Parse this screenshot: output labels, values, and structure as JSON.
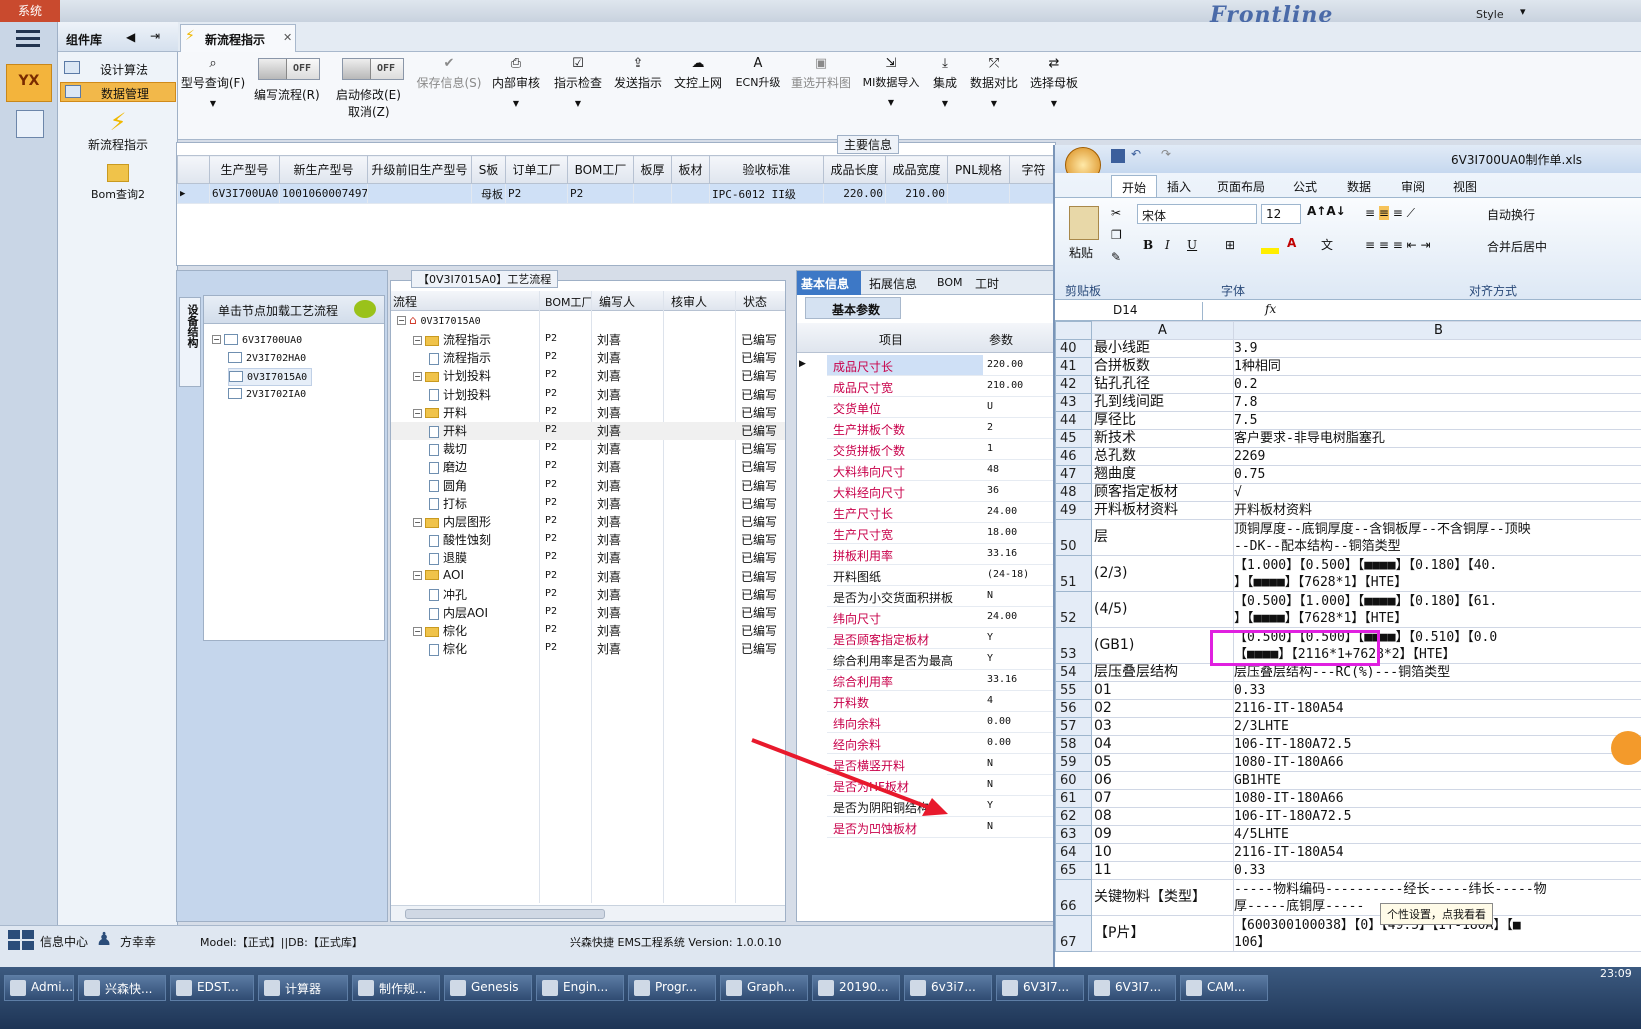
{
  "top": {
    "system_label": "系统",
    "brand": "Frontline",
    "style_label": "Style"
  },
  "sidebar": {
    "logo": "YX",
    "panel_title": "组件库",
    "items": [
      {
        "label": "设计算法"
      },
      {
        "label": "数据管理"
      }
    ],
    "tools": [
      {
        "label": "新流程指示"
      },
      {
        "label": "Bom查询2"
      }
    ]
  },
  "tab": {
    "label": "新流程指示"
  },
  "toolbar": {
    "type_query": "型号查询(F)",
    "write_flow_toggle": "OFF",
    "write_flow": "编写流程(R)",
    "start_modify_toggle": "OFF",
    "start_modify": "启动修改(E)",
    "cancel": "取消(Z)",
    "save": "保存信息(S)",
    "internal_review": "内部审核",
    "instruction_check": "指示检查",
    "send": "发送指示",
    "upload": "文控上网",
    "ecn": "ECN升级",
    "regen": "重选开料图",
    "mi_import": "MI数据导入",
    "integrate": "集成",
    "compare": "数据对比",
    "select_board": "选择母板"
  },
  "main_info": {
    "title": "主要信息",
    "columns": [
      "生产型号",
      "新生产型号",
      "升级前旧生产型号",
      "S板",
      "订单工厂",
      "BOM工厂",
      "板厚",
      "板材",
      "验收标准",
      "成品长度",
      "成品宽度",
      "PNL规格",
      "字符"
    ],
    "row": [
      "6V3I700UA0",
      "10010600074979",
      "",
      "母板",
      "P2",
      "P2",
      "",
      "",
      "IPC-6012 II级",
      "220.00",
      "210.00",
      "",
      ""
    ]
  },
  "struct": {
    "side_tab": "设备结构",
    "hint": "单击节点加载工艺流程",
    "root": "6V3I700UA0",
    "children": [
      "2V3I702HA0",
      "0V3I7015A0",
      "2V3I702IA0"
    ]
  },
  "flow": {
    "title": "【0V3I7015A0】工艺流程",
    "columns": [
      "流程",
      "BOM工厂",
      "编写人",
      "核审人",
      "状态"
    ],
    "root": "0V3I7015A0",
    "rows": [
      {
        "name": "流程指示",
        "level": 1,
        "folder": true,
        "bom": "P2",
        "writer": "刘喜",
        "status": "已编写"
      },
      {
        "name": "流程指示",
        "level": 2,
        "folder": false,
        "bom": "P2",
        "writer": "刘喜",
        "status": "已编写"
      },
      {
        "name": "计划投料",
        "level": 1,
        "folder": true,
        "bom": "P2",
        "writer": "刘喜",
        "status": "已编写"
      },
      {
        "name": "计划投料",
        "level": 2,
        "folder": false,
        "bom": "P2",
        "writer": "刘喜",
        "status": "已编写"
      },
      {
        "name": "开料",
        "level": 1,
        "folder": true,
        "bom": "P2",
        "writer": "刘喜",
        "status": "已编写"
      },
      {
        "name": "开料",
        "level": 2,
        "folder": false,
        "bom": "P2",
        "writer": "刘喜",
        "status": "已编写"
      },
      {
        "name": "裁切",
        "level": 2,
        "folder": false,
        "bom": "P2",
        "writer": "刘喜",
        "status": "已编写"
      },
      {
        "name": "磨边",
        "level": 2,
        "folder": false,
        "bom": "P2",
        "writer": "刘喜",
        "status": "已编写"
      },
      {
        "name": "圆角",
        "level": 2,
        "folder": false,
        "bom": "P2",
        "writer": "刘喜",
        "status": "已编写"
      },
      {
        "name": "打标",
        "level": 2,
        "folder": false,
        "bom": "P2",
        "writer": "刘喜",
        "status": "已编写"
      },
      {
        "name": "内层图形",
        "level": 1,
        "folder": true,
        "bom": "P2",
        "writer": "刘喜",
        "status": "已编写"
      },
      {
        "name": "酸性蚀刻",
        "level": 2,
        "folder": false,
        "bom": "P2",
        "writer": "刘喜",
        "status": "已编写"
      },
      {
        "name": "退膜",
        "level": 2,
        "folder": false,
        "bom": "P2",
        "writer": "刘喜",
        "status": "已编写"
      },
      {
        "name": "AOI",
        "level": 1,
        "folder": true,
        "bom": "P2",
        "writer": "刘喜",
        "status": "已编写"
      },
      {
        "name": "冲孔",
        "level": 2,
        "folder": false,
        "bom": "P2",
        "writer": "刘喜",
        "status": "已编写"
      },
      {
        "name": "内层AOI",
        "level": 2,
        "folder": false,
        "bom": "P2",
        "writer": "刘喜",
        "status": "已编写"
      },
      {
        "name": "棕化",
        "level": 1,
        "folder": true,
        "bom": "P2",
        "writer": "刘喜",
        "status": "已编写"
      },
      {
        "name": "棕化",
        "level": 2,
        "folder": false,
        "bom": "P2",
        "writer": "刘喜",
        "status": "已编写"
      }
    ]
  },
  "params": {
    "tabs": [
      "基本信息",
      "拓展信息",
      "BOM",
      "工时"
    ],
    "subtab": "基本参数",
    "columns": [
      "项目",
      "参数"
    ],
    "rows": [
      {
        "k": "成品尺寸长",
        "v": "220.00",
        "red": true
      },
      {
        "k": "成品尺寸宽",
        "v": "210.00",
        "red": true
      },
      {
        "k": "交货单位",
        "v": "U",
        "red": true
      },
      {
        "k": "生产拼板个数",
        "v": "2",
        "red": true
      },
      {
        "k": "交货拼板个数",
        "v": "1",
        "red": true
      },
      {
        "k": "大料纬向尺寸",
        "v": "48",
        "red": true
      },
      {
        "k": "大料经向尺寸",
        "v": "36",
        "red": true
      },
      {
        "k": "生产尺寸长",
        "v": "24.00",
        "red": true
      },
      {
        "k": "生产尺寸宽",
        "v": "18.00",
        "red": true
      },
      {
        "k": "拼板利用率",
        "v": "33.16",
        "red": true
      },
      {
        "k": "开料图纸",
        "v": "(24-18)",
        "red": false
      },
      {
        "k": "是否为小交货面积拼板",
        "v": "N",
        "red": false
      },
      {
        "k": "纬向尺寸",
        "v": "24.00",
        "red": true
      },
      {
        "k": "是否顾客指定板材",
        "v": "Y",
        "red": true
      },
      {
        "k": "综合利用率是否为最高",
        "v": "Y",
        "red": false
      },
      {
        "k": "综合利用率",
        "v": "33.16",
        "red": true
      },
      {
        "k": "开料数",
        "v": "4",
        "red": true
      },
      {
        "k": "纬向余料",
        "v": "0.00",
        "red": true
      },
      {
        "k": "经向余料",
        "v": "0.00",
        "red": true
      },
      {
        "k": "是否横竖开料",
        "v": "N",
        "red": true
      },
      {
        "k": "是否为HF板材",
        "v": "N",
        "red": true
      },
      {
        "k": "是否为阴阳铜结构",
        "v": "Y",
        "red": false
      },
      {
        "k": "是否为凹蚀板材",
        "v": "N",
        "red": true
      }
    ]
  },
  "status": {
    "info_center": "信息中心",
    "user": "方幸幸",
    "model": "Model:【正式】||DB:【正式库】",
    "system": "兴森快捷 EMS工程系统 Version: 1.0.0.10"
  },
  "excel": {
    "title": "6V3I700UA0制作单.xls",
    "tabs": [
      "开始",
      "插入",
      "页面布局",
      "公式",
      "数据",
      "审阅",
      "视图"
    ],
    "paste": "粘贴",
    "clipboard": "剪贴板",
    "font_name": "宋体",
    "font_size": "12",
    "font_group": "字体",
    "wrap": "自动换行",
    "merge": "合并后居中",
    "align_group": "对齐方式",
    "cell_ref": "D14",
    "fx": "fx",
    "col_a": "A",
    "col_b": "B",
    "tooltip": "个性设置，点我看看",
    "rows": [
      {
        "n": "40",
        "a": "最小线距",
        "b": "3.9"
      },
      {
        "n": "41",
        "a": "合拼板数",
        "b": "1种相同"
      },
      {
        "n": "42",
        "a": "钻孔孔径",
        "b": "0.2"
      },
      {
        "n": "43",
        "a": "孔到线间距",
        "b": "7.8"
      },
      {
        "n": "44",
        "a": "厚径比",
        "b": "7.5"
      },
      {
        "n": "45",
        "a": "新技术",
        "b": "客户要求-非导电树脂塞孔"
      },
      {
        "n": "46",
        "a": "总孔数",
        "b": "2269"
      },
      {
        "n": "47",
        "a": "翘曲度",
        "b": "0.75"
      },
      {
        "n": "48",
        "a": "顾客指定板材",
        "b": "√"
      },
      {
        "n": "49",
        "a": "开料板材资料",
        "b": "开料板材资料"
      },
      {
        "n": "50",
        "a": "层",
        "b": "顶铜厚度--底铜厚度--含铜板厚--不含铜厚--顶映",
        "b2": "--DK--配本结构--铜箔类型"
      },
      {
        "n": "51",
        "a": "(2/3)",
        "b": "【1.000】【0.500】【■■■■】【0.180】【40.",
        "b2": "】【■■■■】【7628*1】【HTE】"
      },
      {
        "n": "52",
        "a": "(4/5)",
        "b": "【0.500】【1.000】【■■■■】【0.180】【61.",
        "b2": "】【■■■■】【7628*1】【HTE】"
      },
      {
        "n": "53",
        "a": "(GB1)",
        "b": "【0.500】【0.500】【■■■■】【0.510】【0.0",
        "b2": "【■■■■】【2116*1+7628*2】【HTE】"
      },
      {
        "n": "54",
        "a": "层压叠层结构",
        "b": "层压叠层结构---RC(%)---铜箔类型"
      },
      {
        "n": "55",
        "a": "01",
        "b": "0.33"
      },
      {
        "n": "56",
        "a": "02",
        "b": "2116-IT-180A54"
      },
      {
        "n": "57",
        "a": "03",
        "b": "2/3LHTE"
      },
      {
        "n": "58",
        "a": "04",
        "b": "106-IT-180A72.5"
      },
      {
        "n": "59",
        "a": "05",
        "b": "1080-IT-180A66"
      },
      {
        "n": "60",
        "a": "06",
        "b": "GB1HTE"
      },
      {
        "n": "61",
        "a": "07",
        "b": "1080-IT-180A66"
      },
      {
        "n": "62",
        "a": "08",
        "b": "106-IT-180A72.5"
      },
      {
        "n": "63",
        "a": "09",
        "b": "4/5LHTE"
      },
      {
        "n": "64",
        "a": "10",
        "b": "2116-IT-180A54"
      },
      {
        "n": "65",
        "a": "11",
        "b": "0.33"
      },
      {
        "n": "66",
        "a": "关键物料【类型】",
        "b": "-----物料编码----------经长-----纬长-----物",
        "b2": "厚-----底铜厚-----"
      },
      {
        "n": "67",
        "a": "【P片】",
        "b": "【600300100038】【0】【49.5】【IT-180A】【■",
        "b2": "106】"
      }
    ]
  },
  "taskbar": {
    "items": [
      "Admi...",
      "兴森快...",
      "EDST...",
      "计算器",
      "制作规...",
      "Genesis",
      "Engin...",
      "Progr...",
      "Graph...",
      "20190...",
      "6v3i7...",
      "6V3I7...",
      "6V3I7...",
      "CAM..."
    ],
    "clock": "23:09"
  },
  "colors": {
    "accent": "#f0a030",
    "selection": "#cfe0f6",
    "red_label": "#c8004a",
    "annotation": "#e8192c",
    "highlight_box": "#e020e0"
  }
}
